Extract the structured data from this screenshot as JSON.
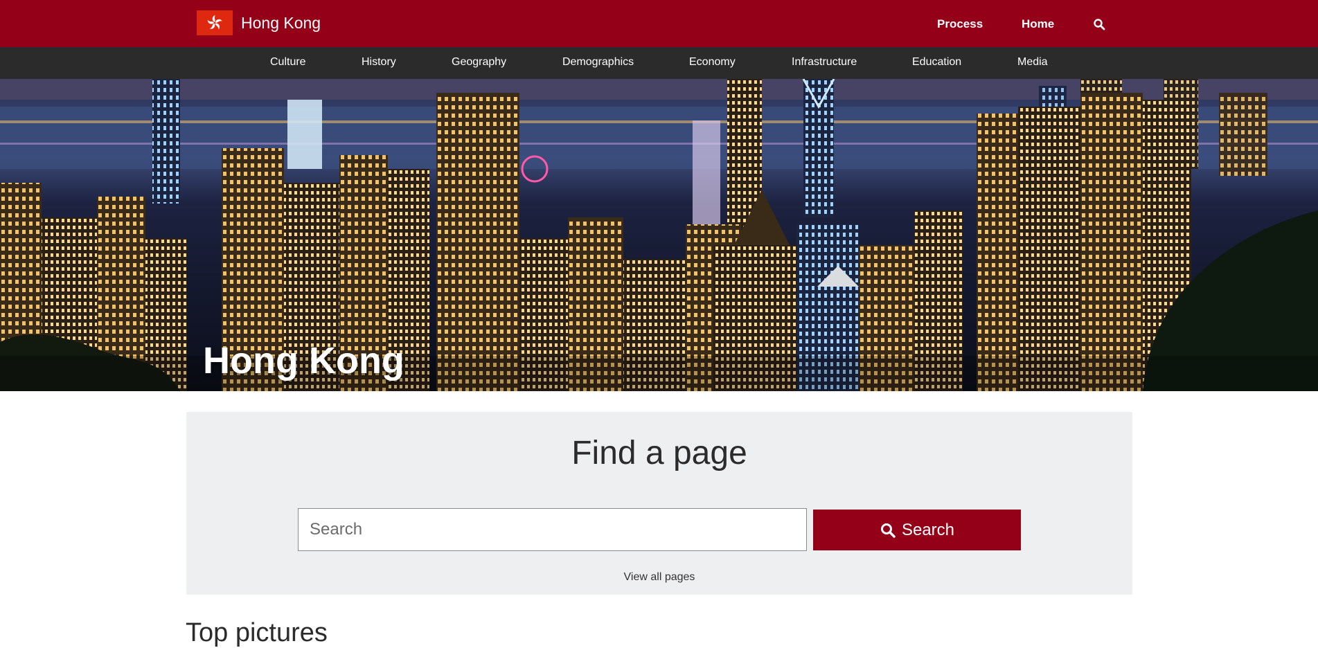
{
  "header": {
    "brand": "Hong Kong",
    "links": {
      "process": "Process",
      "home": "Home"
    },
    "icons": {
      "flag": "bauhinia-flag-icon",
      "search": "search-icon"
    },
    "colors": {
      "header": "#930018",
      "nav": "#2b2b2b",
      "flag": "#de2910"
    }
  },
  "nav": {
    "items": [
      "Culture",
      "History",
      "Geography",
      "Demographics",
      "Economy",
      "Infrastructure",
      "Education",
      "Media"
    ]
  },
  "hero": {
    "title": "Hong Kong"
  },
  "finder": {
    "title": "Find a page",
    "search_placeholder": "Search",
    "search_button": "Search",
    "view_all": "View all pages",
    "colors": {
      "panel": "#edeff0",
      "button": "#930018"
    }
  },
  "sections": {
    "top_pictures": "Top pictures"
  }
}
